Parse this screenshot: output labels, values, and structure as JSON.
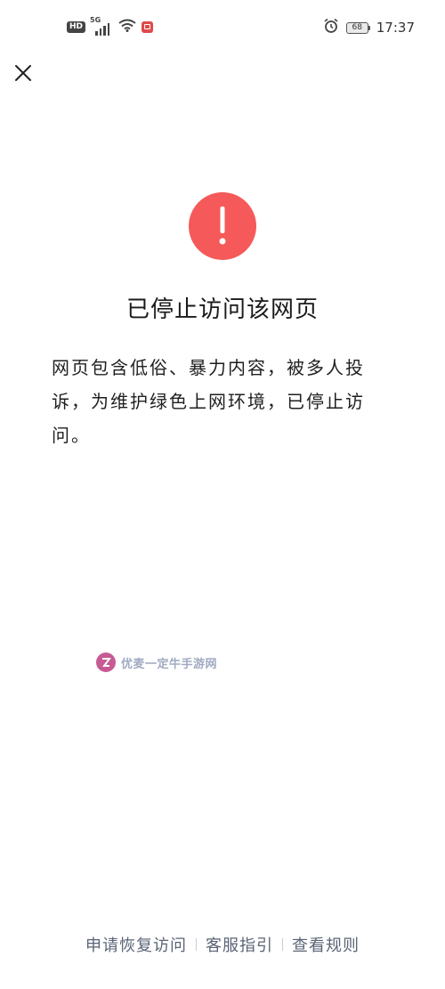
{
  "status_bar": {
    "hd": "HD",
    "network": "5G",
    "battery_level": "68",
    "time": "17:37",
    "icons": [
      "hd-badge",
      "signal-icon",
      "wifi-icon",
      "app-notification-icon",
      "alarm-icon",
      "battery-icon"
    ]
  },
  "nav": {
    "close_icon": "close-icon"
  },
  "warning": {
    "icon": "exclamation-icon",
    "color": "#f55959",
    "title": "已停止访问该网页",
    "message": "网页包含低俗、暴力内容，被多人投诉，为维护绿色上网环境，已停止访问。"
  },
  "watermark": {
    "text": "优麦一定牛手游网",
    "logo_color": "#c75a94"
  },
  "footer": {
    "links": [
      {
        "label": "申请恢复访问"
      },
      {
        "label": "客服指引"
      },
      {
        "label": "查看规则"
      }
    ],
    "link_color": "#5a6476"
  }
}
